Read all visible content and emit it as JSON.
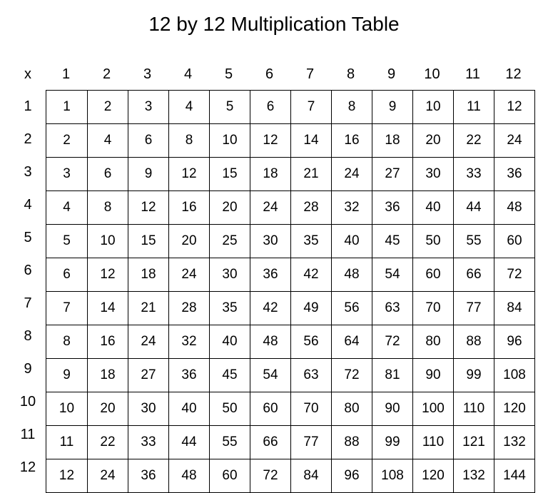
{
  "title": "12 by 12 Multiplication Table",
  "corner": "x",
  "col_headers": [
    "1",
    "2",
    "3",
    "4",
    "5",
    "6",
    "7",
    "8",
    "9",
    "10",
    "11",
    "12"
  ],
  "row_headers": [
    "1",
    "2",
    "3",
    "4",
    "5",
    "6",
    "7",
    "8",
    "9",
    "10",
    "11",
    "12"
  ],
  "chart_data": {
    "type": "table",
    "title": "12 by 12 Multiplication Table",
    "columns": [
      1,
      2,
      3,
      4,
      5,
      6,
      7,
      8,
      9,
      10,
      11,
      12
    ],
    "rows": [
      1,
      2,
      3,
      4,
      5,
      6,
      7,
      8,
      9,
      10,
      11,
      12
    ],
    "values": [
      [
        1,
        2,
        3,
        4,
        5,
        6,
        7,
        8,
        9,
        10,
        11,
        12
      ],
      [
        2,
        4,
        6,
        8,
        10,
        12,
        14,
        16,
        18,
        20,
        22,
        24
      ],
      [
        3,
        6,
        9,
        12,
        15,
        18,
        21,
        24,
        27,
        30,
        33,
        36
      ],
      [
        4,
        8,
        12,
        16,
        20,
        24,
        28,
        32,
        36,
        40,
        44,
        48
      ],
      [
        5,
        10,
        15,
        20,
        25,
        30,
        35,
        40,
        45,
        50,
        55,
        60
      ],
      [
        6,
        12,
        18,
        24,
        30,
        36,
        42,
        48,
        54,
        60,
        66,
        72
      ],
      [
        7,
        14,
        21,
        28,
        35,
        42,
        49,
        56,
        63,
        70,
        77,
        84
      ],
      [
        8,
        16,
        24,
        32,
        40,
        48,
        56,
        64,
        72,
        80,
        88,
        96
      ],
      [
        9,
        18,
        27,
        36,
        45,
        54,
        63,
        72,
        81,
        90,
        99,
        108
      ],
      [
        10,
        20,
        30,
        40,
        50,
        60,
        70,
        80,
        90,
        100,
        110,
        120
      ],
      [
        11,
        22,
        33,
        44,
        55,
        66,
        77,
        88,
        99,
        110,
        121,
        132
      ],
      [
        12,
        24,
        36,
        48,
        60,
        72,
        84,
        96,
        108,
        120,
        132,
        144
      ]
    ]
  }
}
